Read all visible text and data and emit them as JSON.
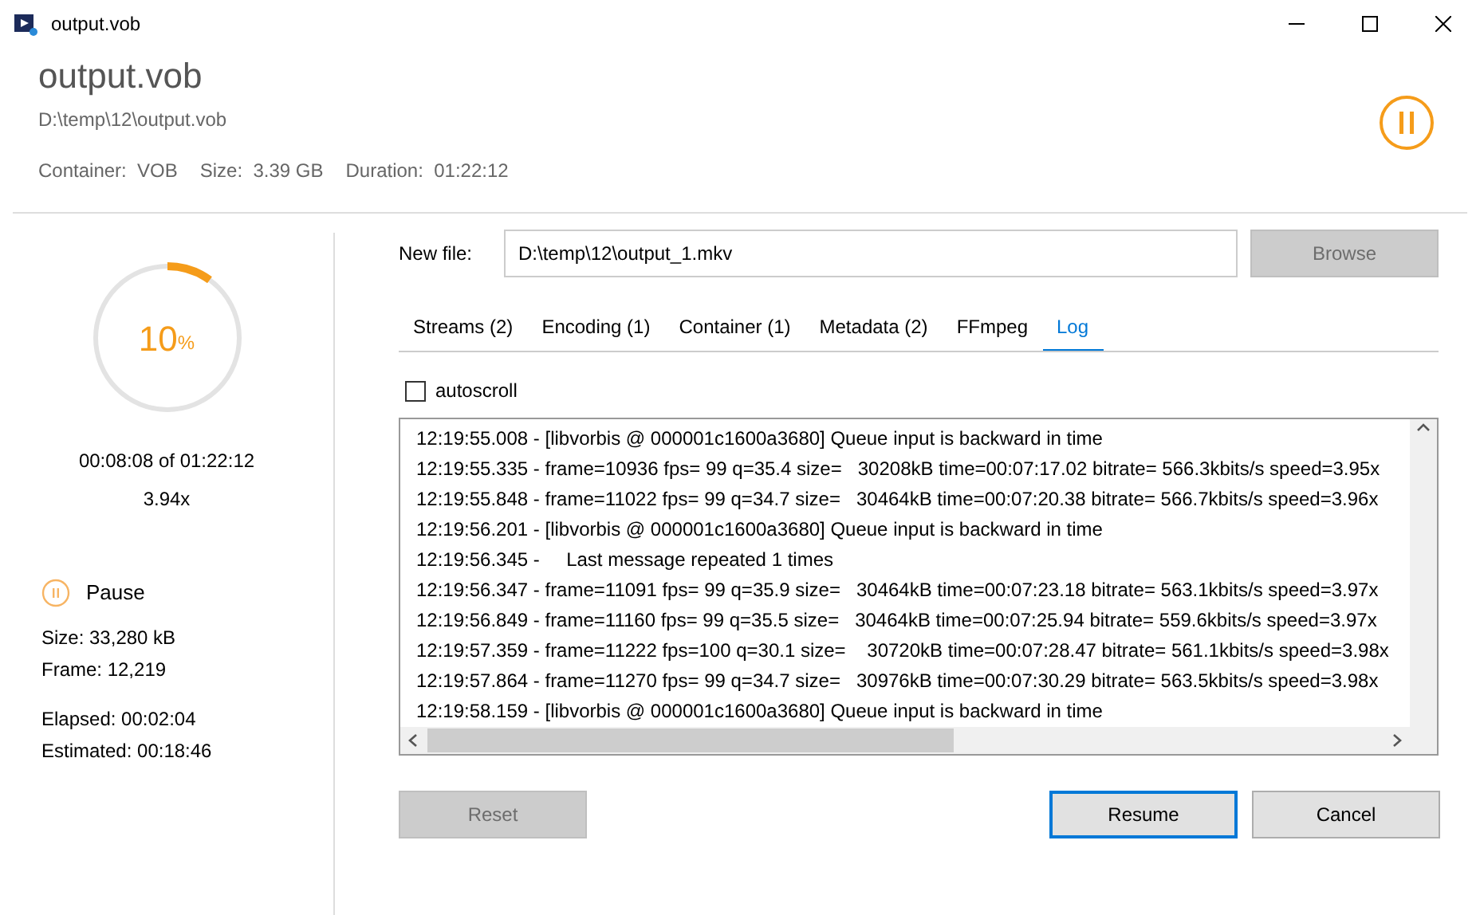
{
  "window": {
    "title": "output.vob"
  },
  "header": {
    "name": "output.vob",
    "path": "D:\\temp\\12\\output.vob",
    "info": [
      {
        "label": "Container:",
        "value": "VOB"
      },
      {
        "label": "Size:",
        "value": "3.39 GB"
      },
      {
        "label": "Duration:",
        "value": "01:22:12"
      }
    ],
    "paused": true
  },
  "progress": {
    "level": 0.1,
    "percent": "10",
    "unit": "%",
    "position": "00:08:08 of 01:22:12",
    "speed": "3.94x"
  },
  "pause": {
    "label": "Pause"
  },
  "stat_groups": [
    [
      "Size: 33,280 kB",
      "Frame: 12,219"
    ],
    [
      "Elapsed: 00:02:04",
      "Estimated: 00:18:46"
    ]
  ],
  "new_file": {
    "label": "New file:",
    "value": "D:\\temp\\12\\output_1.mkv",
    "browse": "Browse",
    "browse_disabled": true
  },
  "tabs": [
    {
      "label": "Streams (2)",
      "selected": false
    },
    {
      "label": "Encoding (1)",
      "selected": false
    },
    {
      "label": "Container (1)",
      "selected": false
    },
    {
      "label": "Metadata (2)",
      "selected": false
    },
    {
      "label": "FFmpeg",
      "selected": false
    },
    {
      "label": "Log",
      "selected": true
    }
  ],
  "autoscroll": {
    "label": "autoscroll",
    "checked": false
  },
  "log": [
    "12:19:55.008 - [libvorbis @ 000001c1600a3680] Queue input is backward in time",
    "12:19:55.335 - frame=10936 fps= 99 q=35.4 size=   30208kB time=00:07:17.02 bitrate= 566.3kbits/s speed=3.95x",
    "12:19:55.848 - frame=11022 fps= 99 q=34.7 size=   30464kB time=00:07:20.38 bitrate= 566.7kbits/s speed=3.96x",
    "12:19:56.201 - [libvorbis @ 000001c1600a3680] Queue input is backward in time",
    "12:19:56.345 -     Last message repeated 1 times",
    "12:19:56.347 - frame=11091 fps= 99 q=35.9 size=   30464kB time=00:07:23.18 bitrate= 563.1kbits/s speed=3.97x",
    "12:19:56.849 - frame=11160 fps= 99 q=35.5 size=   30464kB time=00:07:25.94 bitrate= 559.6kbits/s speed=3.97x",
    "12:19:57.359 - frame=11222 fps=100 q=30.1 size=    30720kB time=00:07:28.47 bitrate= 561.1kbits/s speed=3.98x",
    "12:19:57.864 - frame=11270 fps= 99 q=34.7 size=   30976kB time=00:07:30.29 bitrate= 563.5kbits/s speed=3.98x",
    "12:19:58.159 - [libvorbis @ 000001c1600a3680] Queue input is backward in time"
  ],
  "buttons": [
    {
      "label": "Reset",
      "disabled": true,
      "default": false
    },
    {
      "label": "Resume",
      "disabled": false,
      "default": true
    },
    {
      "label": "Cancel",
      "disabled": false,
      "default": false
    }
  ]
}
